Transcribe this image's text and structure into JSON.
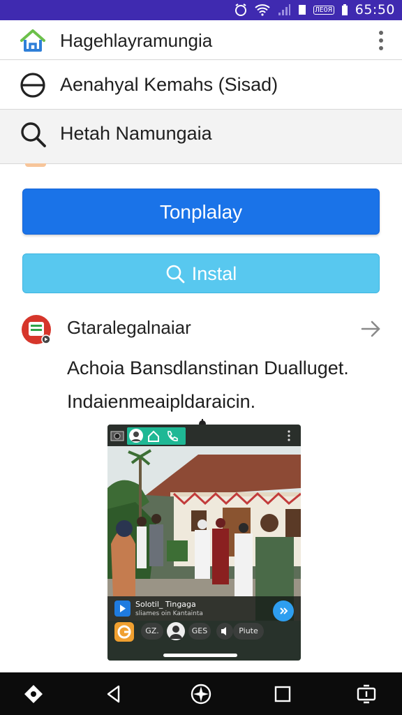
{
  "status_bar": {
    "time": "65:50",
    "box_label": "ЛЕОЯ"
  },
  "header": {
    "title": "Hagehlayramungia"
  },
  "row_two": {
    "label": "Aenahyal Kemahs (Sisad)"
  },
  "search_row": {
    "label": "Hetah Namungaia"
  },
  "buttons": {
    "primary_label": "Tonplalay",
    "secondary_label": "Instal"
  },
  "app": {
    "name": "Gtaralegalnaiar",
    "description_line1": "Achoia Bansdlanstinan Dualluget.",
    "description_line2": "Indaienmeaipldaraicin."
  },
  "preview": {
    "overlay_title": "Solotil_ Tingaga",
    "overlay_subtitle": "sliames oin Kantainta",
    "chips": [
      "GZ.",
      "GES",
      "Piute"
    ]
  },
  "colors": {
    "status_bar": "#3f2ab0",
    "primary_button": "#1a73e8",
    "secondary_button": "#58c8ef",
    "nav_bar": "#0c0c0c"
  }
}
